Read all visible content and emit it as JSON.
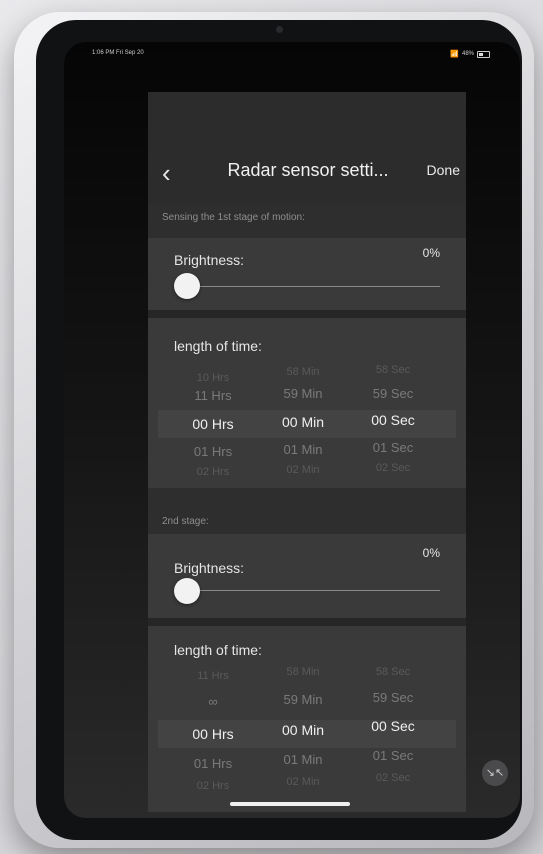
{
  "status_bar": {
    "time": "1:06 PM  Fri Sep 20",
    "battery": "48%"
  },
  "navbar": {
    "title": "Radar sensor setti...",
    "done_label": "Done"
  },
  "stage1": {
    "caption": "Sensing the 1st stage of motion:",
    "brightness_label": "Brightness:",
    "brightness_value": "0%",
    "brightness_level": 0,
    "time_label": "length of time:",
    "hours": [
      "10 Hrs",
      "11 Hrs",
      "00 Hrs",
      "01 Hrs",
      "02 Hrs"
    ],
    "minutes": [
      "58 Min",
      "59 Min",
      "00 Min",
      "01 Min",
      "02 Min"
    ],
    "seconds": [
      "58 Sec",
      "59 Sec",
      "00 Sec",
      "01 Sec",
      "02 Sec"
    ]
  },
  "stage2": {
    "caption": "2nd stage:",
    "brightness_label": "Brightness:",
    "brightness_value": "0%",
    "brightness_level": 0,
    "time_label": "length of time:",
    "hours": [
      "11 Hrs",
      "∞",
      "00 Hrs",
      "01 Hrs",
      "02 Hrs"
    ],
    "minutes": [
      "58 Min",
      "59 Min",
      "00 Min",
      "01 Min",
      "02 Min"
    ],
    "seconds": [
      "58 Sec",
      "59 Sec",
      "00 Sec",
      "01 Sec",
      "02 Sec"
    ]
  },
  "icons": {
    "back": "chevron-left-icon",
    "collapse": "collapse-arrows-icon",
    "wifi": "wifi-icon",
    "battery": "battery-icon"
  }
}
